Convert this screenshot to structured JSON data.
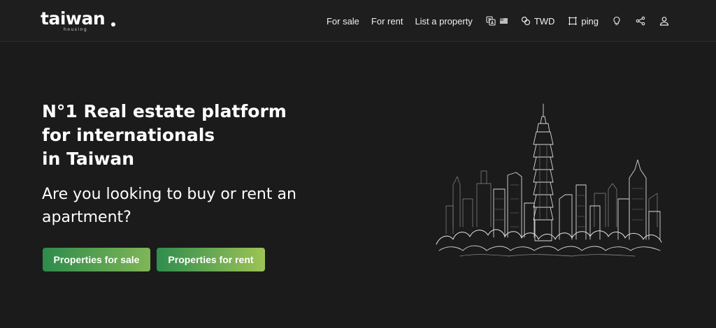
{
  "header": {
    "logo": {
      "word": "taiwan",
      "sub": "housing"
    },
    "nav": {
      "for_sale": "For sale",
      "for_rent": "For rent",
      "list_property": "List a property",
      "currency": "TWD",
      "unit": "ping"
    },
    "icons": [
      "translate-icon",
      "flag-icon",
      "currency-icon",
      "area-unit-icon",
      "lightbulb-icon",
      "share-icon",
      "user-icon"
    ]
  },
  "hero": {
    "title_lines": [
      "N°1 Real estate platform",
      "for internationals",
      "in Taiwan"
    ],
    "subtitle": "Are you looking to buy or rent an apartment?",
    "buttons": {
      "sale": "Properties for sale",
      "rent": "Properties for rent"
    },
    "illustration": "taipei-skyline-sketch"
  },
  "colors": {
    "background": "#1b1b1b",
    "header_bg": "#1e1e1e",
    "button_green_start": "#2e8b4c",
    "button_green_end": "#9ec356"
  }
}
